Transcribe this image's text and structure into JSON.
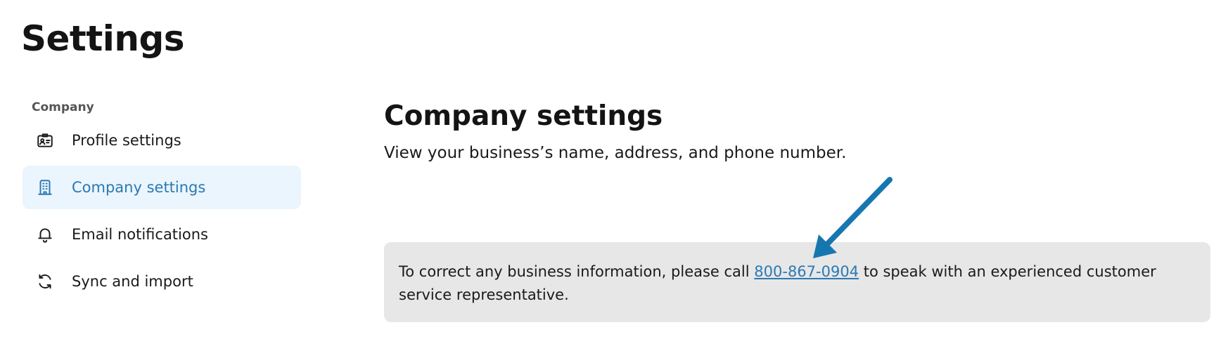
{
  "page": {
    "title": "Settings"
  },
  "sidebar": {
    "section_label": "Company",
    "items": [
      {
        "label": "Profile settings",
        "icon": "id-card-icon",
        "active": false
      },
      {
        "label": "Company settings",
        "icon": "building-icon",
        "active": true
      },
      {
        "label": "Email notifications",
        "icon": "bell-icon",
        "active": false
      },
      {
        "label": "Sync and import",
        "icon": "sync-icon",
        "active": false
      }
    ]
  },
  "main": {
    "title": "Company settings",
    "subtitle": "View your business’s name, address, and phone number.",
    "notice": {
      "text_before": "To correct any business information, please call ",
      "phone": "800-867-0904",
      "text_after": " to speak with an experienced customer service representative."
    }
  },
  "colors": {
    "accent": "#2b79b2",
    "active_bg": "#eaf5fd",
    "notice_bg": "#e7e7e7",
    "annotation_arrow": "#1677b0"
  }
}
